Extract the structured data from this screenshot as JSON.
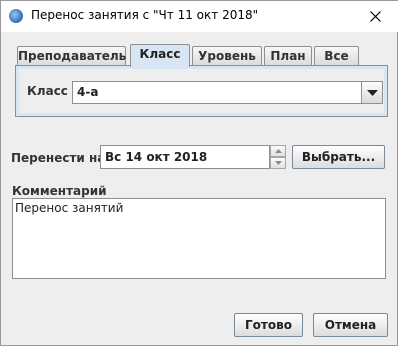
{
  "window": {
    "title": "Перенос занятия с \"Чт 11 окт 2018\""
  },
  "icons": {
    "app": "calendar-globe-icon",
    "close": "close-icon",
    "dropdown": "chevron-down-icon",
    "spin_up": "triangle-up-icon",
    "spin_down": "triangle-down-icon"
  },
  "tabs": [
    {
      "label": "Преподаватель",
      "active": false
    },
    {
      "label": "Класс",
      "active": true
    },
    {
      "label": "Уровень",
      "active": false
    },
    {
      "label": "План",
      "active": false
    },
    {
      "label": "Все",
      "active": false
    }
  ],
  "class_panel": {
    "label": "Класс",
    "selected_value": "4-а"
  },
  "reschedule": {
    "label": "Перенести на",
    "date_value": "Вс 14 окт 2018",
    "choose_button": "Выбрать..."
  },
  "comment": {
    "label": "Комментарий",
    "value": "Перенос занятий"
  },
  "footer": {
    "ok_button": "Готово",
    "cancel_button": "Отмена"
  },
  "colors": {
    "accent": "#d8e6f3",
    "background": "#eeeeee"
  }
}
